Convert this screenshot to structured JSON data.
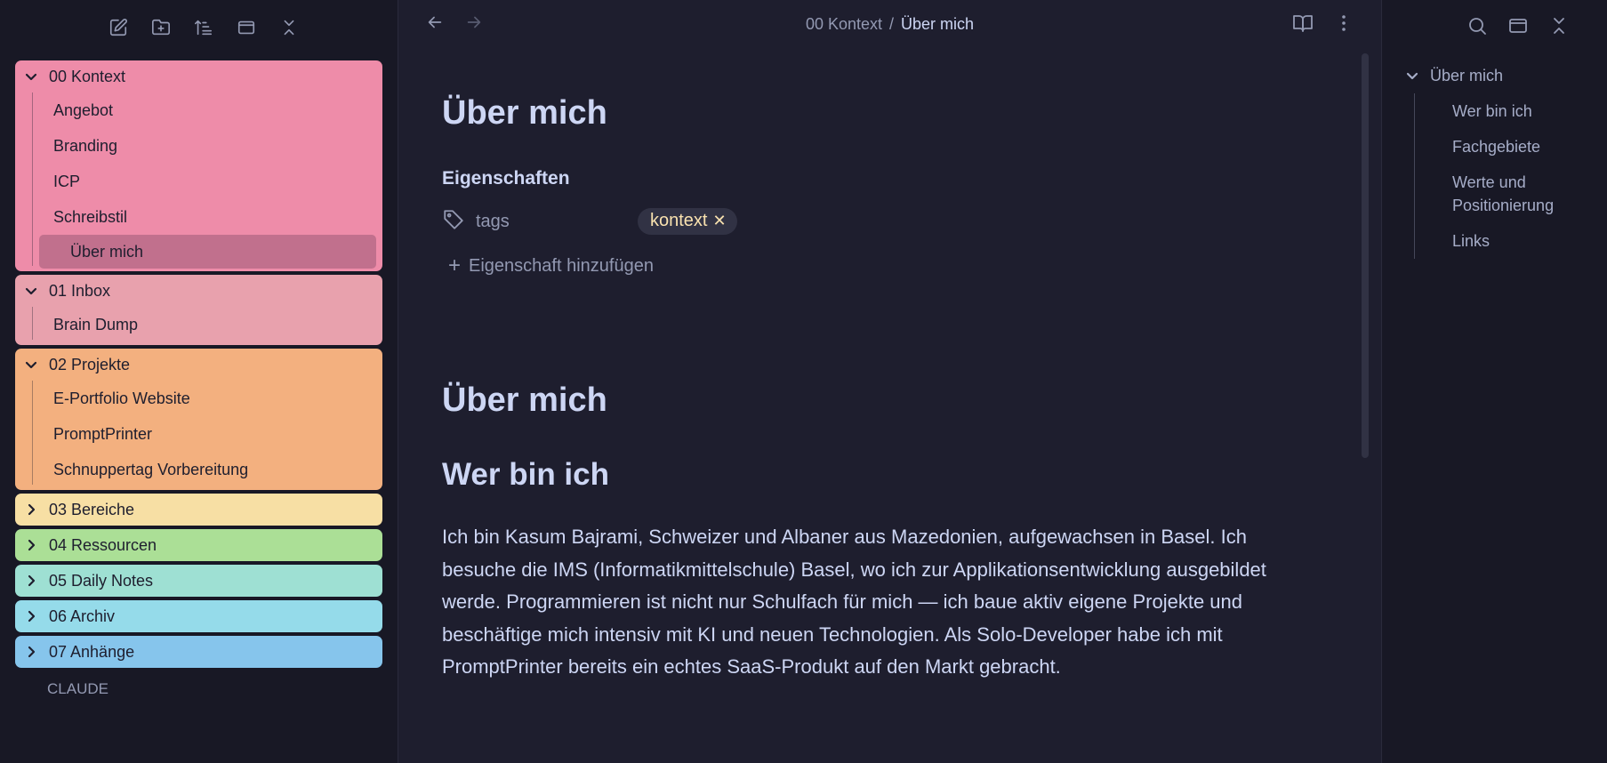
{
  "left_toolbar": {
    "icons": [
      "new-note-icon",
      "new-folder-icon",
      "sort-icon",
      "layout-icon",
      "collapse-all-icon"
    ]
  },
  "tree": {
    "folders": [
      {
        "name": "00 Kontext",
        "expanded": true,
        "color": "#ee8ca9",
        "children": [
          "Angebot",
          "Branding",
          "ICP",
          "Schreibstil",
          "Über mich"
        ],
        "active_child": "Über mich"
      },
      {
        "name": "01 Inbox",
        "expanded": true,
        "color": "#e8a1ad",
        "children": [
          "Brain Dump"
        ]
      },
      {
        "name": "02 Projekte",
        "expanded": true,
        "color": "#f3b07f",
        "children": [
          "E-Portfolio Website",
          "PromptPrinter",
          "Schnuppertag Vorbereitung"
        ]
      },
      {
        "name": "03 Bereiche",
        "expanded": false,
        "color": "#f7dfa4"
      },
      {
        "name": "04 Ressourcen",
        "expanded": false,
        "color": "#abdf96"
      },
      {
        "name": "05 Daily Notes",
        "expanded": false,
        "color": "#9ee0d3"
      },
      {
        "name": "06 Archiv",
        "expanded": false,
        "color": "#95dbea"
      },
      {
        "name": "07 Anhänge",
        "expanded": false,
        "color": "#86c5ec"
      }
    ],
    "loose_file": "CLAUDE"
  },
  "breadcrumb": {
    "parent": "00 Kontext",
    "separator": "/",
    "current": "Über mich"
  },
  "note": {
    "title": "Über mich",
    "properties_heading": "Eigenschaften",
    "property_key": "tags",
    "property_tag": "kontext",
    "add_property": "Eigenschaft hinzufügen",
    "h1": "Über mich",
    "h2": "Wer bin ich",
    "paragraph": "Ich bin Kasum Bajrami, Schweizer und Albaner aus Mazedonien, aufgewachsen in Basel. Ich besuche die IMS (Informatikmittelschule) Basel, wo ich zur Applikationsentwicklung ausgebildet werde. Programmieren ist nicht nur Schulfach für mich — ich baue aktiv eigene Projekte und beschäftige mich intensiv mit KI und neuen Technologien. Als Solo-Developer habe ich mit PromptPrinter bereits ein echtes SaaS-Produkt auf den Markt gebracht."
  },
  "outline": {
    "root": "Über mich",
    "items": [
      "Wer bin ich",
      "Fachgebiete",
      "Werte und Positionierung",
      "Links"
    ]
  },
  "colors": {
    "background": "#1e1e2e",
    "sidebar": "#181825",
    "text": "#cdd6f4",
    "muted": "#9399b2",
    "tag_text": "#f9e2af"
  }
}
